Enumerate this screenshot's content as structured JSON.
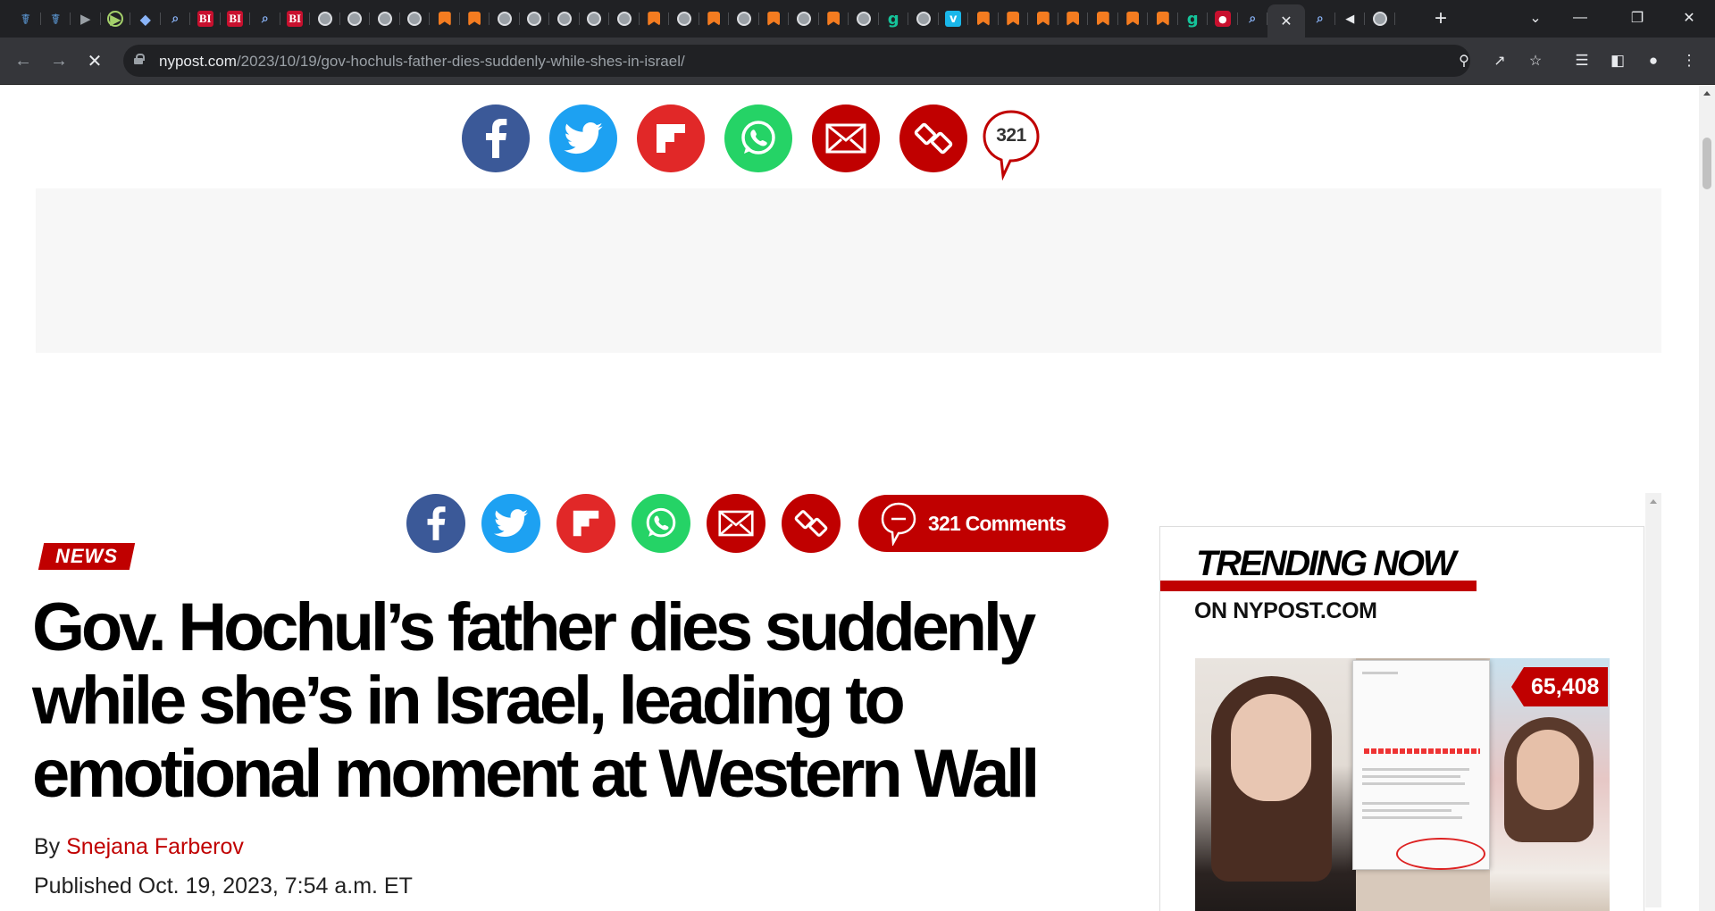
{
  "browser": {
    "tabs": [
      {
        "icon": "shield-icon",
        "glyph": "☤"
      },
      {
        "icon": "shield-icon",
        "glyph": "☤"
      },
      {
        "icon": "arrow-icon",
        "glyph": "▶"
      },
      {
        "icon": "play-icon",
        "glyph": "▶"
      },
      {
        "icon": "graduation-cap-icon",
        "glyph": "◆"
      },
      {
        "icon": "search-icon",
        "glyph": "⌕"
      },
      {
        "icon": "business-insider-icon",
        "glyph": "BI"
      },
      {
        "icon": "business-insider-icon",
        "glyph": "BI"
      },
      {
        "icon": "search-icon",
        "glyph": "⌕"
      },
      {
        "icon": "business-insider-icon",
        "glyph": "BI"
      },
      {
        "icon": "globe-icon",
        "glyph": ""
      },
      {
        "icon": "globe-icon",
        "glyph": ""
      },
      {
        "icon": "globe-icon",
        "glyph": ""
      },
      {
        "icon": "globe-icon",
        "glyph": ""
      },
      {
        "icon": "bookmark-icon",
        "glyph": ""
      },
      {
        "icon": "bookmark-icon",
        "glyph": ""
      },
      {
        "icon": "globe-icon",
        "glyph": ""
      },
      {
        "icon": "globe-icon",
        "glyph": ""
      },
      {
        "icon": "globe-icon",
        "glyph": ""
      },
      {
        "icon": "globe-icon",
        "glyph": ""
      },
      {
        "icon": "globe-icon",
        "glyph": ""
      },
      {
        "icon": "bookmark-icon",
        "glyph": ""
      },
      {
        "icon": "globe-icon",
        "glyph": ""
      },
      {
        "icon": "bookmark-icon",
        "glyph": ""
      },
      {
        "icon": "globe-icon",
        "glyph": ""
      },
      {
        "icon": "bookmark-icon",
        "glyph": ""
      },
      {
        "icon": "globe-icon",
        "glyph": ""
      },
      {
        "icon": "bookmark-icon",
        "glyph": ""
      },
      {
        "icon": "globe-icon",
        "glyph": ""
      },
      {
        "icon": "grammarly-icon",
        "glyph": "g"
      },
      {
        "icon": "globe-icon",
        "glyph": ""
      },
      {
        "icon": "vimeo-icon",
        "glyph": "v"
      },
      {
        "icon": "bookmark-icon",
        "glyph": ""
      },
      {
        "icon": "bookmark-icon",
        "glyph": ""
      },
      {
        "icon": "bookmark-icon",
        "glyph": ""
      },
      {
        "icon": "bookmark-icon",
        "glyph": ""
      },
      {
        "icon": "bookmark-icon",
        "glyph": ""
      },
      {
        "icon": "bookmark-icon",
        "glyph": ""
      },
      {
        "icon": "bookmark-icon",
        "glyph": ""
      },
      {
        "icon": "grammarly-icon",
        "glyph": "g"
      },
      {
        "icon": "microphone-icon",
        "glyph": "●"
      },
      {
        "icon": "search-icon",
        "glyph": "⌕"
      },
      {
        "icon": "close-icon",
        "glyph": "✕",
        "active": true
      },
      {
        "icon": "search-icon",
        "glyph": "⌕"
      },
      {
        "icon": "speaker-icon",
        "glyph": "◀"
      },
      {
        "icon": "globe-icon",
        "glyph": ""
      }
    ],
    "new_tab_glyph": "+",
    "url_host": "nypost.com",
    "url_path": "/2023/10/19/gov-hochuls-father-dies-suddenly-while-shes-in-israel/"
  },
  "share_top": {
    "comment_count": "321"
  },
  "share_main": {
    "comments_label": "321 Comments"
  },
  "article": {
    "section_tag": "NEWS",
    "headline": "Gov. Hochul’s father dies suddenly while she’s in Israel, leading to emotional moment at Western Wall",
    "byline_prefix": "By ",
    "author": "Snejana Farberov",
    "published": "Published Oct. 19, 2023, 7:54 a.m. ET"
  },
  "sidebar": {
    "title": "TRENDING NOW",
    "subtitle": "ON NYPOST.COM",
    "story_count": "65,408"
  },
  "colors": {
    "brand_red": "#c00000",
    "facebook": "#3b5998",
    "twitter": "#1da1f2",
    "flipboard": "#e12828",
    "whatsapp": "#25d366"
  }
}
